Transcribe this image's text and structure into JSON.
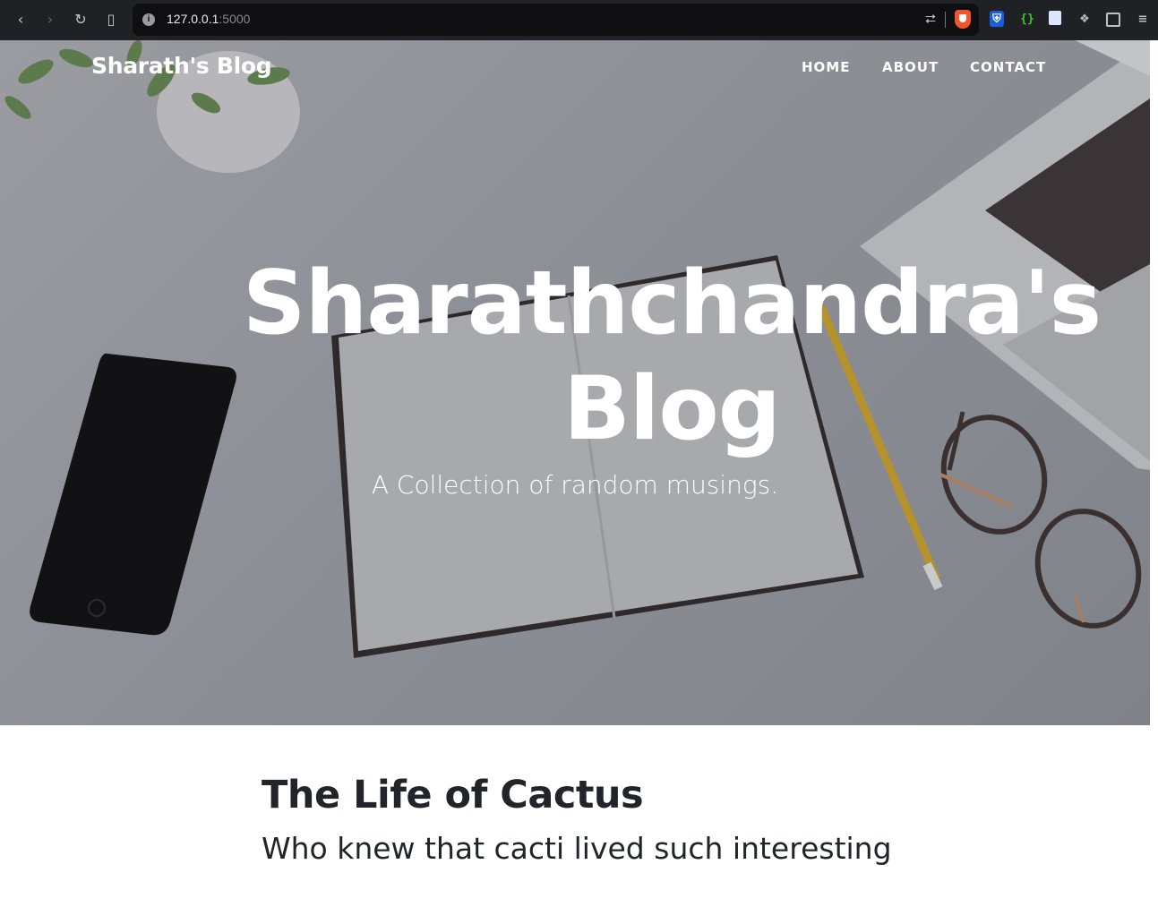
{
  "browser": {
    "url_host": "127.0.0.1",
    "url_port": ":5000",
    "back_icon": "chevron-left-icon",
    "forward_icon": "chevron-right-icon",
    "reload_icon": "reload-icon",
    "bookmark_icon": "bookmark-icon"
  },
  "navbar": {
    "brand": "Sharath's Blog",
    "links": [
      "HOME",
      "ABOUT",
      "CONTACT"
    ]
  },
  "hero": {
    "heading": "Sharathchandra's Blog",
    "subheading": "A Collection of random musings."
  },
  "posts": [
    {
      "title": "The Life of Cactus",
      "subtitle": "Who knew that cacti lived such interesting"
    }
  ],
  "colors": {
    "chrome_bg": "#202124",
    "omnibox_bg": "#0f0f12",
    "text_dark": "#212529",
    "brave_orange": "#f1562b",
    "bitwarden_blue": "#175ddc"
  }
}
